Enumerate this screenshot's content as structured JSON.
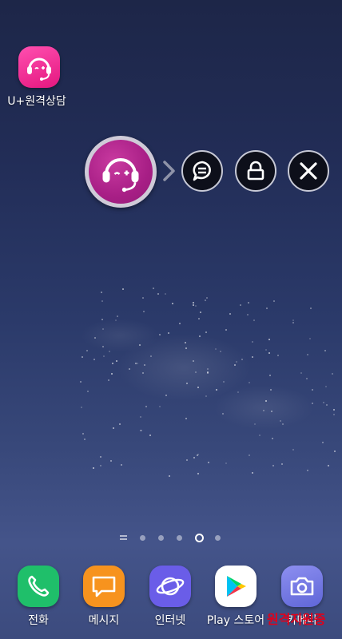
{
  "desktop": {
    "app": {
      "label": "U+원격상담",
      "icon": "headset-icon",
      "color": "#e4177f"
    }
  },
  "floating_widget": {
    "main_icon": "headset-icon",
    "expand_icon": "chevron-right-icon",
    "actions": [
      {
        "icon": "chat-icon"
      },
      {
        "icon": "lock-icon"
      },
      {
        "icon": "close-icon"
      }
    ]
  },
  "page_indicator": {
    "pages": 5,
    "active_index": 3
  },
  "dock": {
    "apps": [
      {
        "label": "전화",
        "icon": "phone-icon",
        "color": "#1fbf6a"
      },
      {
        "label": "메시지",
        "icon": "message-icon",
        "color": "#f7931e"
      },
      {
        "label": "인터넷",
        "icon": "internet-icon",
        "color": "#6a5de8"
      },
      {
        "label": "Play 스토어",
        "icon": "play-store-icon",
        "color": "#ffffff"
      },
      {
        "label": "카메라",
        "icon": "camera-icon",
        "color": "#7a7fe6"
      }
    ]
  },
  "watermark": "원격지원중"
}
